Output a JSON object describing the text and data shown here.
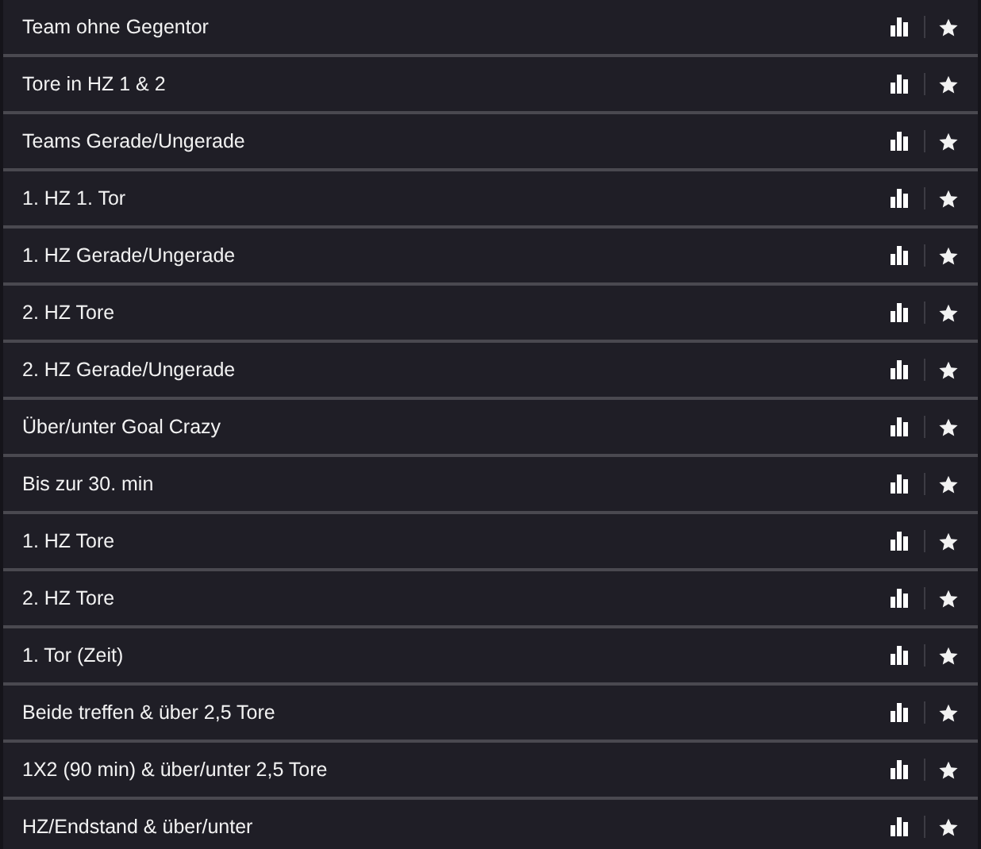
{
  "markets": [
    {
      "label": "Team ohne Gegentor"
    },
    {
      "label": "Tore in HZ 1 & 2"
    },
    {
      "label": "Teams Gerade/Ungerade"
    },
    {
      "label": "1. HZ 1. Tor"
    },
    {
      "label": "1. HZ Gerade/Ungerade"
    },
    {
      "label": "2. HZ Tore"
    },
    {
      "label": "2. HZ Gerade/Ungerade"
    },
    {
      "label": "Über/unter Goal Crazy"
    },
    {
      "label": "Bis zur 30. min"
    },
    {
      "label": "1. HZ Tore"
    },
    {
      "label": "2. HZ Tore"
    },
    {
      "label": "1. Tor (Zeit)"
    },
    {
      "label": "Beide treffen & über 2,5 Tore"
    },
    {
      "label": "1X2 (90 min) & über/unter 2,5 Tore"
    },
    {
      "label": "HZ/Endstand & über/unter"
    }
  ]
}
